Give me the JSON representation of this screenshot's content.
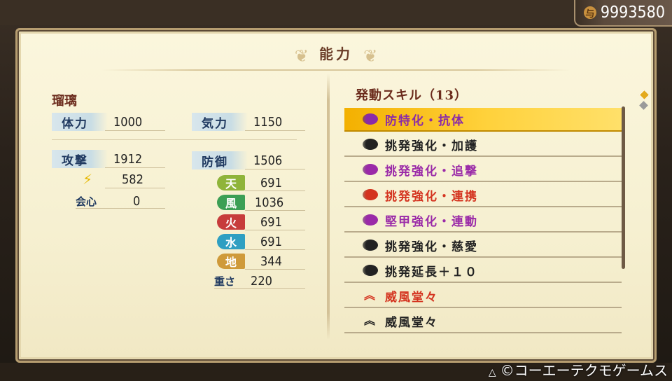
{
  "money": "9993580",
  "coin_icon_glyph": "与",
  "title": "能力",
  "character_name": "瑠璃",
  "stats": {
    "hp_label": "体力",
    "hp_value": "1000",
    "ki_label": "気力",
    "ki_value": "1150",
    "attack_label": "攻撃",
    "attack_value": "1912",
    "defense_label": "防御",
    "defense_value": "1506",
    "lightning_value": "582",
    "critical_label": "会心",
    "critical_value": "0",
    "weight_label": "重さ",
    "weight_value": "220"
  },
  "elements": [
    {
      "label": "天",
      "value": "691",
      "color": "#8fb43a"
    },
    {
      "label": "風",
      "value": "1036",
      "color": "#3c9f55"
    },
    {
      "label": "火",
      "value": "691",
      "color": "#c73c3c"
    },
    {
      "label": "水",
      "value": "691",
      "color": "#2f9fc2"
    },
    {
      "label": "地",
      "value": "344",
      "color": "#cf9a3a"
    }
  ],
  "skills_header": "発動スキル（13）",
  "skills": [
    {
      "name": "防特化・抗体",
      "color": "#8a2aa8",
      "icon": "purple-orb-icon"
    },
    {
      "name": "挑発強化・加護",
      "color": "#222222",
      "icon": "dark-orb-icon"
    },
    {
      "name": "挑発強化・追撃",
      "color": "#9a2aa8",
      "icon": "purple-orb-icon"
    },
    {
      "name": "挑発強化・連携",
      "color": "#d4331f",
      "icon": "red-orb-icon"
    },
    {
      "name": "堅甲強化・連動",
      "color": "#9a2aa8",
      "icon": "purple-orb-icon"
    },
    {
      "name": "挑発強化・慈愛",
      "color": "#222222",
      "icon": "dark-orb-icon"
    },
    {
      "name": "挑発延長＋１０",
      "color": "#222222",
      "icon": "dark-orb-icon"
    },
    {
      "name": "威風堂々",
      "color": "#d4331f",
      "icon": "red-chevron-icon"
    },
    {
      "name": "威風堂々",
      "color": "#222222",
      "icon": "dark-chevron-icon"
    }
  ],
  "copyright": "©コーエーテクモゲームス"
}
